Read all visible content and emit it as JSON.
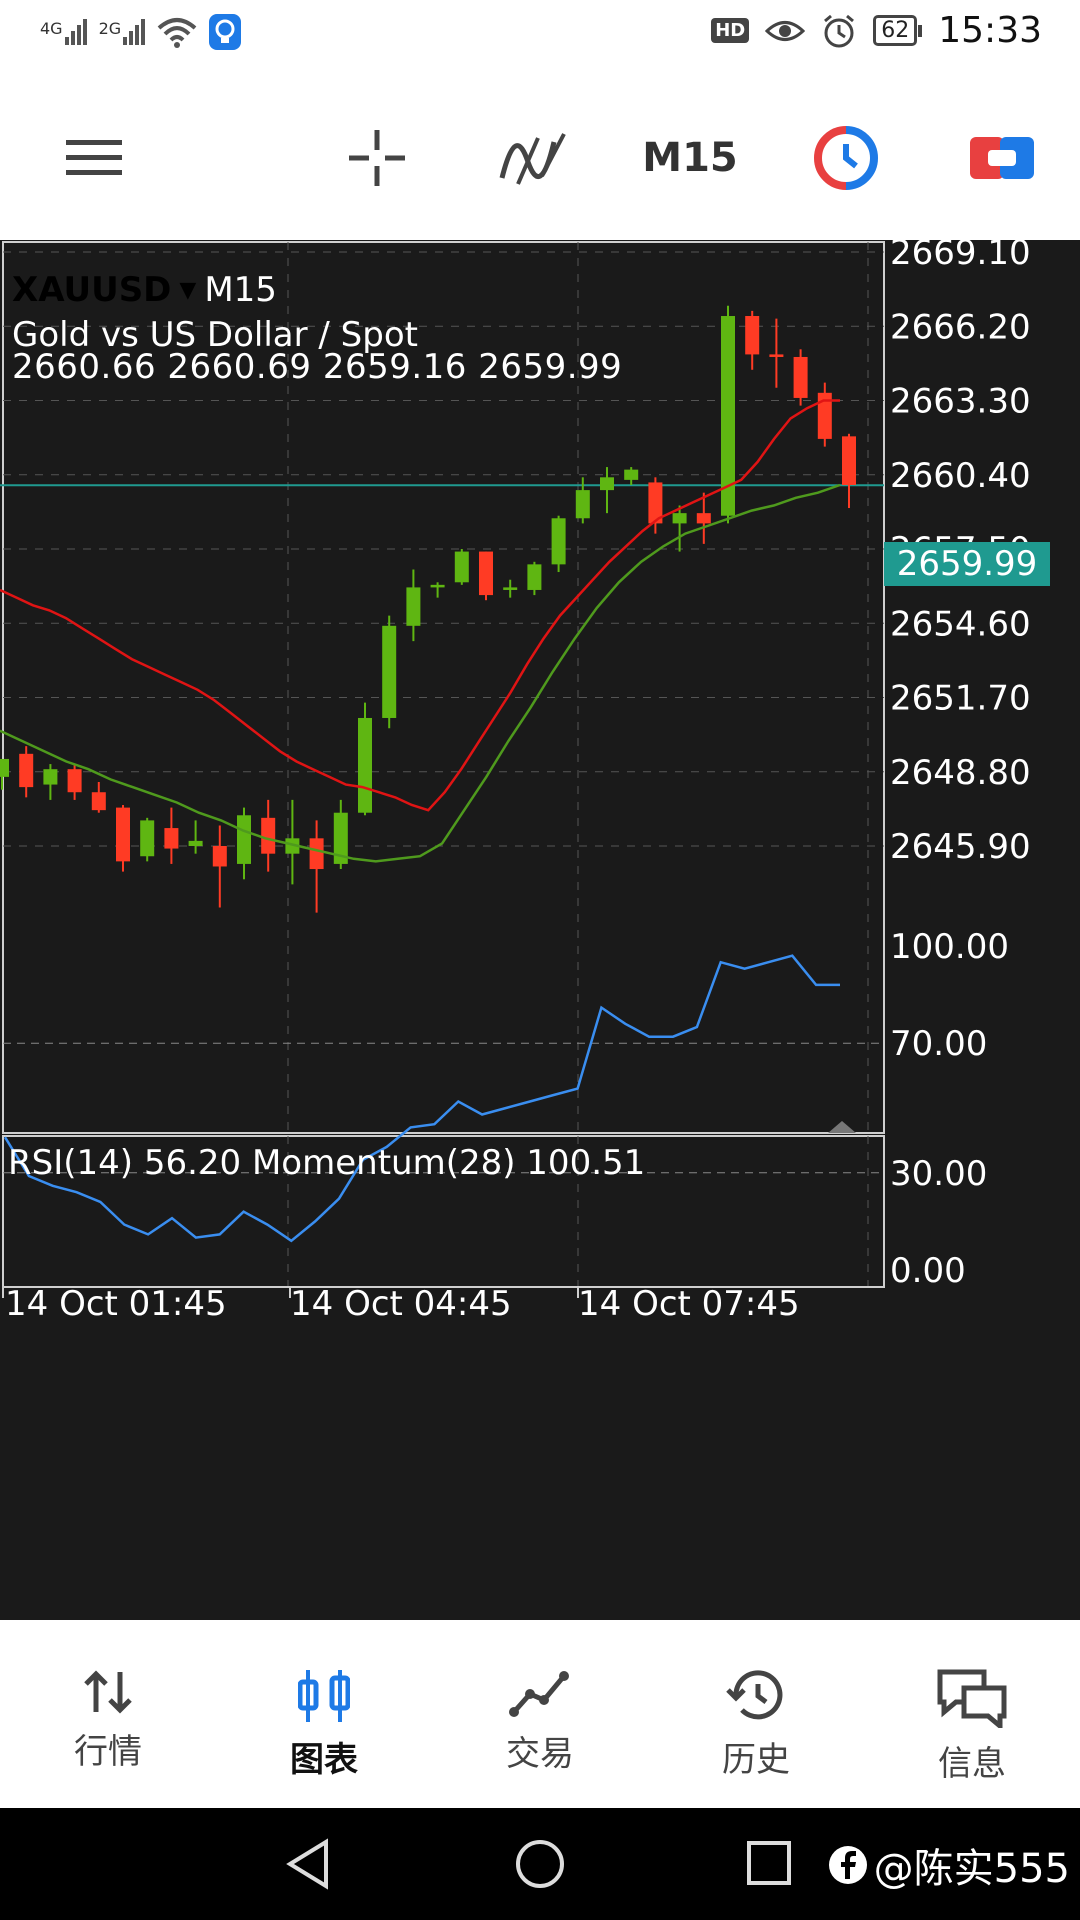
{
  "status_bar": {
    "signal_1": "4G",
    "signal_2": "2G",
    "battery": "62",
    "time": "15:33",
    "hd_badge": "HD"
  },
  "toolbar": {
    "timeframe": "M15"
  },
  "chart": {
    "symbol": "XAUUSD",
    "timeframe": "M15",
    "description": "Gold vs US Dollar / Spot",
    "ohlc": "2660.66 2660.69 2659.16 2659.99",
    "current_price": "2659.99",
    "price_axis": [
      "2669.10",
      "2666.20",
      "2663.30",
      "2660.40",
      "2657.50",
      "2654.60",
      "2651.70",
      "2648.80",
      "2645.90"
    ],
    "indicator_label": "RSI(14) 56.20 Momentum(28) 100.51",
    "rsi_axis": [
      "100.00",
      "70.00",
      "30.00",
      "0.00"
    ],
    "time_axis": [
      "14 Oct 01:45",
      "14 Oct 04:45",
      "14 Oct 07:45"
    ],
    "colors": {
      "bull": "#5fb612",
      "bear": "#ff3b24",
      "ma_fast": "#e01414",
      "ma_slow": "#4f9a1d",
      "rsi": "#3a8ef0",
      "price_line": "#1f9a90"
    }
  },
  "chart_data": {
    "type": "candlestick",
    "ylim": [
      2643.0,
      2670.0
    ],
    "candles": [
      {
        "o": 2648.6,
        "h": 2649.0,
        "l": 2648.1,
        "c": 2649.3
      },
      {
        "o": 2649.5,
        "h": 2649.8,
        "l": 2647.8,
        "c": 2648.2
      },
      {
        "o": 2648.3,
        "h": 2649.1,
        "l": 2647.7,
        "c": 2648.9
      },
      {
        "o": 2648.9,
        "h": 2649.1,
        "l": 2647.7,
        "c": 2648.0
      },
      {
        "o": 2648.0,
        "h": 2648.4,
        "l": 2647.2,
        "c": 2647.3
      },
      {
        "o": 2647.4,
        "h": 2647.5,
        "l": 2644.9,
        "c": 2645.3
      },
      {
        "o": 2645.5,
        "h": 2647.0,
        "l": 2645.3,
        "c": 2646.9
      },
      {
        "o": 2646.6,
        "h": 2647.4,
        "l": 2645.2,
        "c": 2645.8
      },
      {
        "o": 2645.9,
        "h": 2646.9,
        "l": 2645.6,
        "c": 2646.1
      },
      {
        "o": 2645.9,
        "h": 2646.7,
        "l": 2643.5,
        "c": 2645.1
      },
      {
        "o": 2645.2,
        "h": 2647.4,
        "l": 2644.6,
        "c": 2647.1
      },
      {
        "o": 2647.0,
        "h": 2647.7,
        "l": 2644.9,
        "c": 2645.6
      },
      {
        "o": 2645.6,
        "h": 2647.7,
        "l": 2644.4,
        "c": 2646.2
      },
      {
        "o": 2646.2,
        "h": 2646.9,
        "l": 2643.3,
        "c": 2645.0
      },
      {
        "o": 2645.2,
        "h": 2647.7,
        "l": 2645.0,
        "c": 2647.2
      },
      {
        "o": 2647.2,
        "h": 2651.5,
        "l": 2647.1,
        "c": 2650.9
      },
      {
        "o": 2650.9,
        "h": 2654.9,
        "l": 2650.5,
        "c": 2654.5
      },
      {
        "o": 2654.5,
        "h": 2656.7,
        "l": 2653.9,
        "c": 2656.0
      },
      {
        "o": 2656.0,
        "h": 2656.2,
        "l": 2655.6,
        "c": 2656.1
      },
      {
        "o": 2656.2,
        "h": 2657.5,
        "l": 2656.1,
        "c": 2657.4
      },
      {
        "o": 2657.4,
        "h": 2657.4,
        "l": 2655.5,
        "c": 2655.7
      },
      {
        "o": 2655.9,
        "h": 2656.3,
        "l": 2655.6,
        "c": 2656.0
      },
      {
        "o": 2655.9,
        "h": 2657.0,
        "l": 2655.7,
        "c": 2656.9
      },
      {
        "o": 2656.9,
        "h": 2658.8,
        "l": 2656.6,
        "c": 2658.7
      },
      {
        "o": 2658.7,
        "h": 2660.3,
        "l": 2658.5,
        "c": 2659.8
      },
      {
        "o": 2659.8,
        "h": 2660.7,
        "l": 2658.9,
        "c": 2660.3
      },
      {
        "o": 2660.2,
        "h": 2660.7,
        "l": 2660.0,
        "c": 2660.6
      },
      {
        "o": 2660.1,
        "h": 2660.3,
        "l": 2658.1,
        "c": 2658.5
      },
      {
        "o": 2658.5,
        "h": 2659.2,
        "l": 2657.4,
        "c": 2658.9
      },
      {
        "o": 2658.9,
        "h": 2659.7,
        "l": 2657.7,
        "c": 2658.5
      },
      {
        "o": 2658.8,
        "h": 2667.0,
        "l": 2658.5,
        "c": 2666.6
      },
      {
        "o": 2666.6,
        "h": 2666.8,
        "l": 2664.5,
        "c": 2665.1
      },
      {
        "o": 2665.1,
        "h": 2666.5,
        "l": 2663.8,
        "c": 2665.0
      },
      {
        "o": 2665.0,
        "h": 2665.3,
        "l": 2663.1,
        "c": 2663.4
      },
      {
        "o": 2663.6,
        "h": 2664.0,
        "l": 2661.5,
        "c": 2661.8
      },
      {
        "o": 2661.9,
        "h": 2662.0,
        "l": 2659.1,
        "c": 2660.0
      }
    ],
    "ma_fast": [
      2655.9,
      2655.6,
      2655.3,
      2655.1,
      2654.8,
      2654.4,
      2654.0,
      2653.6,
      2653.2,
      2652.9,
      2652.6,
      2652.3,
      2652.0,
      2651.6,
      2651.1,
      2650.6,
      2650.1,
      2649.6,
      2649.2,
      2648.9,
      2648.6,
      2648.3,
      2648.2,
      2648.0,
      2647.8,
      2647.5,
      2647.3,
      2648.0,
      2648.9,
      2649.9,
      2650.9,
      2651.9,
      2653.0,
      2654.0,
      2654.9,
      2655.6,
      2656.3,
      2657.0,
      2657.6,
      2658.2,
      2658.7,
      2659.0,
      2659.3,
      2659.6,
      2659.9,
      2660.2,
      2660.9,
      2661.8,
      2662.6,
      2663.0,
      2663.3,
      2663.3
    ],
    "ma_slow": [
      2650.4,
      2650.0,
      2649.6,
      2649.2,
      2648.9,
      2648.5,
      2648.2,
      2647.9,
      2647.6,
      2647.2,
      2646.9,
      2646.5,
      2646.2,
      2646.0,
      2645.8,
      2645.6,
      2645.4,
      2645.3,
      2645.4,
      2645.5,
      2646.0,
      2647.3,
      2648.6,
      2650.0,
      2651.3,
      2652.7,
      2654.0,
      2655.2,
      2656.2,
      2657.0,
      2657.6,
      2658.1,
      2658.4,
      2658.7,
      2659.0,
      2659.2,
      2659.5,
      2659.7,
      2660.0
    ],
    "rsi": [
      41,
      29,
      26,
      24,
      21,
      14,
      11,
      16,
      10,
      11,
      18,
      14,
      9,
      15,
      22,
      34,
      38,
      44,
      45,
      52,
      48,
      50,
      52,
      54,
      56,
      81,
      76,
      72,
      72,
      75,
      95,
      93,
      95,
      97,
      88,
      88
    ]
  },
  "bottom_nav": {
    "items": [
      {
        "label": "行情",
        "icon": "quotes-arrows-icon"
      },
      {
        "label": "图表",
        "icon": "chart-candles-icon"
      },
      {
        "label": "交易",
        "icon": "trade-line-icon"
      },
      {
        "label": "历史",
        "icon": "history-clock-icon"
      },
      {
        "label": "信息",
        "icon": "messages-icon"
      }
    ],
    "active": "图表"
  },
  "watermark": {
    "text": "@陈实555"
  }
}
